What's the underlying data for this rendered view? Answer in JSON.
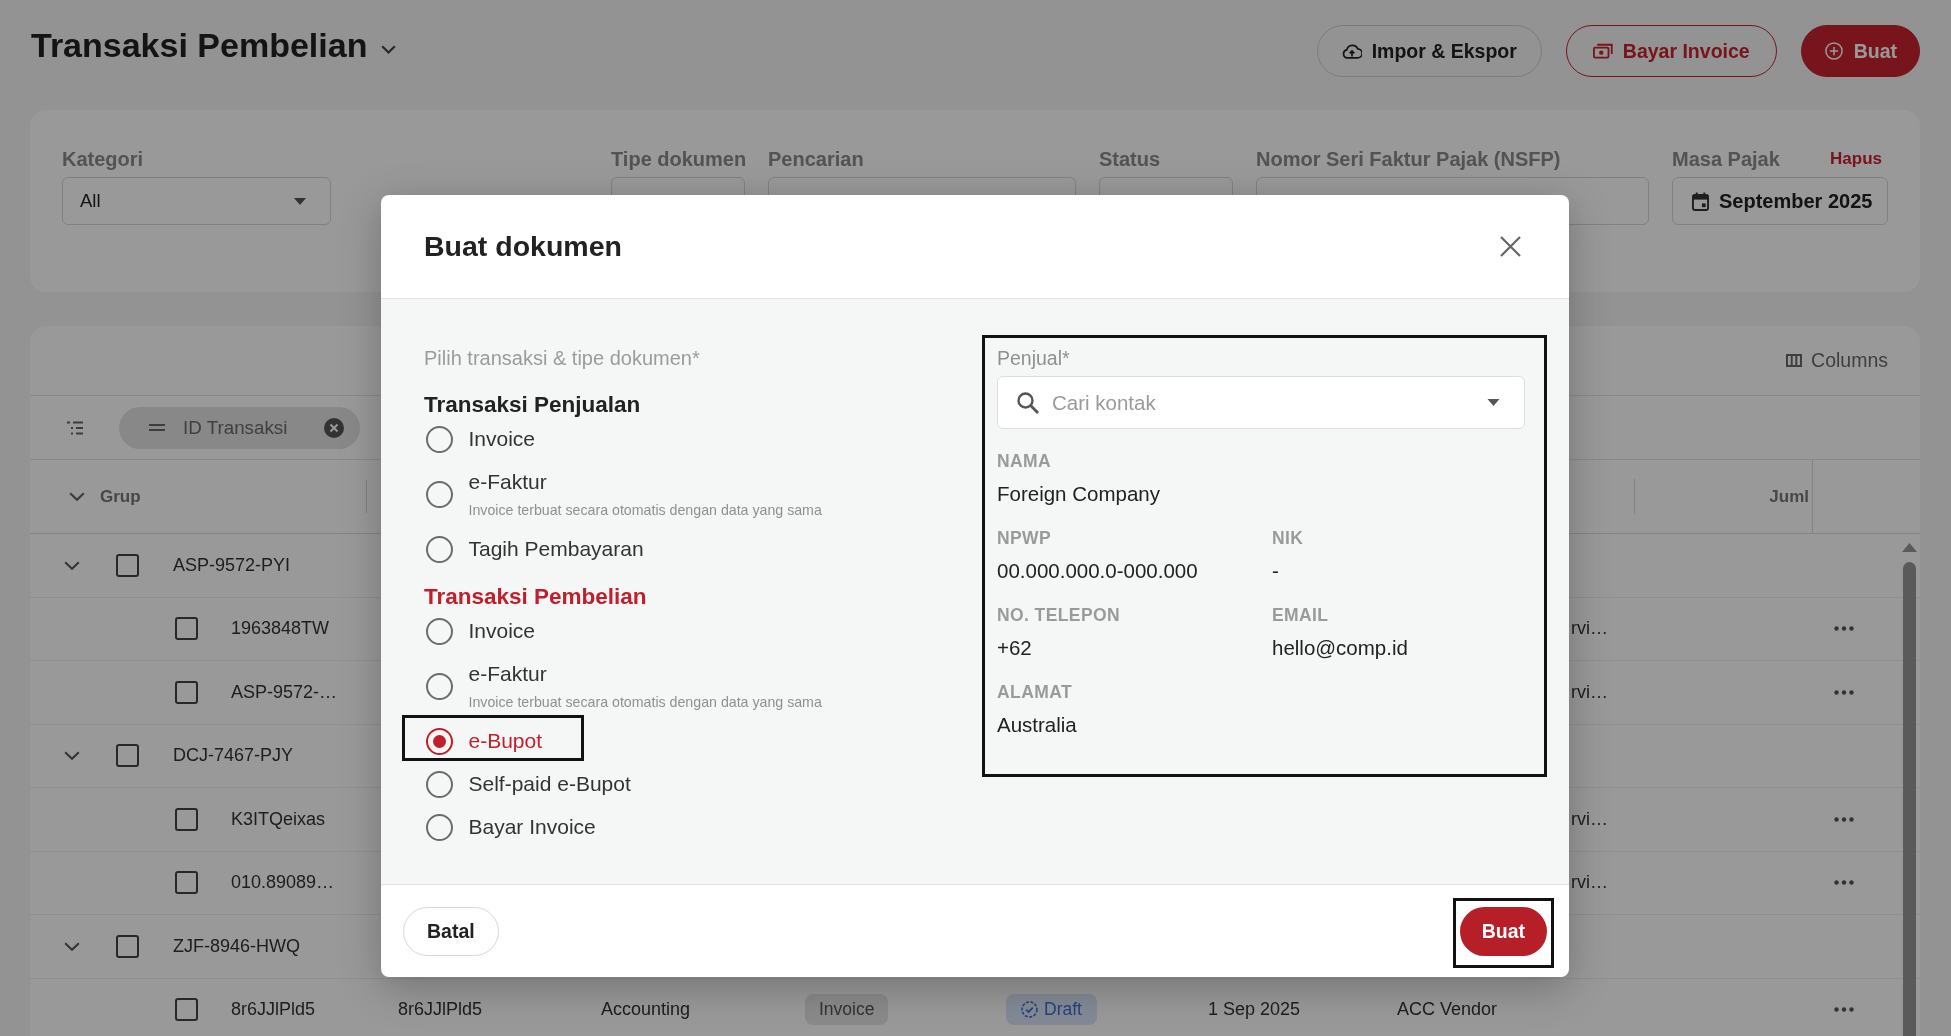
{
  "page": {
    "title": "Transaksi Pembelian",
    "actions": [
      {
        "label": "Impor & Ekspor",
        "kind": "outline"
      },
      {
        "label": "Bayar Invoice",
        "kind": "accent-outline"
      },
      {
        "label": "Buat",
        "kind": "primary"
      }
    ]
  },
  "filters": {
    "fields": [
      {
        "label": "Kategori",
        "kind": "select",
        "value": "All"
      },
      {
        "label": "Tipe dokumen",
        "kind": "text"
      },
      {
        "label": "Pencarian",
        "kind": "text"
      },
      {
        "label": "Status",
        "kind": "text"
      },
      {
        "label": "Nomor Seri Faktur Pajak (NSFP)",
        "kind": "text"
      },
      {
        "label": "Masa Pajak",
        "kind": "date",
        "value": "September 2025",
        "link": "Hapus"
      }
    ]
  },
  "table": {
    "columns_button": "Columns",
    "group_chip": "ID Transaksi",
    "header": {
      "column_1": "Grup",
      "column_9": "Juml"
    },
    "groups": [
      {
        "id": "ASP-9572-PYI",
        "expanded": true,
        "checked": false,
        "children": [
          {
            "id": "1963848TW",
            "checked": false,
            "cells": {
              "column_8": "rvi…"
            }
          },
          {
            "id": "ASP-9572-…",
            "checked": false,
            "cells": {
              "column_8": "rvi…"
            }
          }
        ]
      },
      {
        "id": "DCJ-7467-PJY",
        "expanded": true,
        "checked": false,
        "children": [
          {
            "id": "K3ITQeixas",
            "checked": false,
            "cells": {
              "column_8": "rvi…"
            }
          },
          {
            "id": "010.89089…",
            "checked": false,
            "cells": {
              "column_8": "rvi…"
            }
          }
        ]
      },
      {
        "id": "ZJF-8946-HWQ",
        "expanded": true,
        "checked": false,
        "children": [
          {
            "id": "8r6JJlPld5",
            "checked": false,
            "cells": {
              "column_2": "8r6JJlPld5",
              "column_3": "Accounting",
              "column_4": "Invoice",
              "column_5": "Draft",
              "column_6": "1 Sep 2025",
              "column_7": "ACC Vendor"
            }
          }
        ]
      }
    ]
  },
  "dialog": {
    "title": "Buat dokumen",
    "prompt": "Pilih transaksi & tipe dokumen*",
    "sections": [
      {
        "title": "Transaksi Penjualan",
        "active": false,
        "options": [
          {
            "label": "Invoice",
            "selected": false,
            "highlighted": false
          },
          {
            "label": "e-Faktur",
            "note": "Invoice terbuat secara otomatis dengan data yang sama",
            "selected": false,
            "highlighted": false
          },
          {
            "label": "Tagih Pembayaran",
            "selected": false,
            "highlighted": false
          }
        ]
      },
      {
        "title": "Transaksi Pembelian",
        "active": true,
        "options": [
          {
            "label": "Invoice",
            "selected": false,
            "highlighted": false
          },
          {
            "label": "e-Faktur",
            "note": "Invoice terbuat secara otomatis dengan data yang sama",
            "selected": false,
            "highlighted": false
          },
          {
            "label": "e-Bupot",
            "selected": true,
            "highlighted": true
          },
          {
            "label": "Self-paid e-Bupot",
            "selected": false,
            "highlighted": false
          },
          {
            "label": "Bayar Invoice",
            "selected": false,
            "highlighted": false
          }
        ]
      }
    ],
    "seller": {
      "label": "Penjual*",
      "placeholder": "Cari kontak",
      "highlighted": true,
      "rows": [
        {
          "fields": [
            {
              "label": "NAMA",
              "value": "Foreign Company"
            }
          ]
        },
        {
          "fields": [
            {
              "label": "NPWP",
              "value": "00.000.000.0-000.000"
            },
            {
              "label": "NIK",
              "value": "-"
            }
          ]
        },
        {
          "fields": [
            {
              "label": "NO. TELEPON",
              "value": "+62"
            },
            {
              "label": "EMAIL",
              "value": "hello@comp.id"
            }
          ]
        },
        {
          "fields": [
            {
              "label": "ALAMAT",
              "value": "Australia"
            }
          ]
        }
      ]
    },
    "buttons": [
      {
        "label": "Batal",
        "kind": "secondary",
        "highlighted": false
      },
      {
        "label": "Buat",
        "kind": "primary",
        "highlighted": true
      }
    ]
  }
}
